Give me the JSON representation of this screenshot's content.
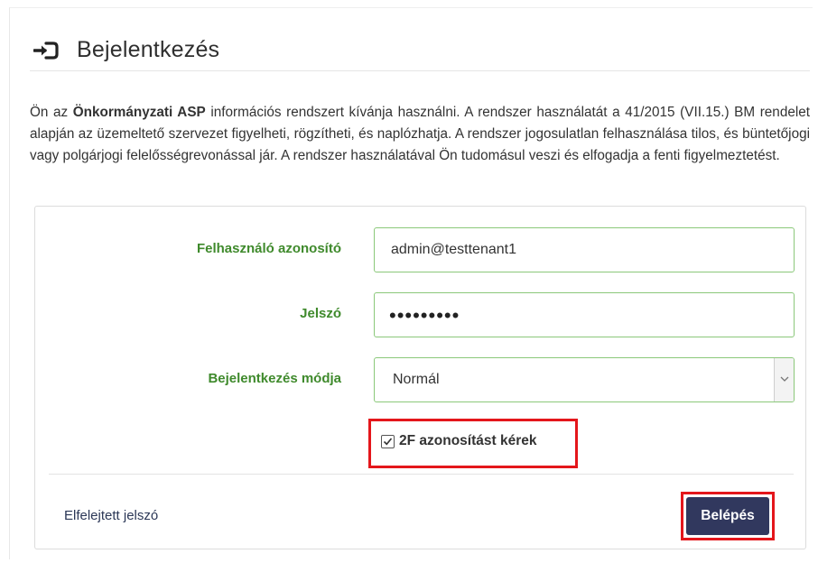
{
  "header": {
    "title": "Bejelentkezés",
    "icon": "login-icon"
  },
  "intro": {
    "part1": "Ön az ",
    "bold": "Önkormányzati ASP",
    "part2": " információs rendszert kívánja használni. A rendszer használatát a 41/2015 (VII.15.) BM rendelet alapján az üzemeltető szervezet figyelheti, rögzítheti, és naplózhatja. A rendszer jogosulatlan felhasználása tilos, és büntetőjogi vagy polgárjogi felelősségrevonással jár. A rendszer használatával Ön tudomásul veszi és elfogadja a fenti figyelmeztetést."
  },
  "form": {
    "username": {
      "label": "Felhasználó azonosító",
      "value": "admin@testtenant1"
    },
    "password": {
      "label": "Jelszó",
      "value": "•••••••••"
    },
    "login_mode": {
      "label": "Bejelentkezés módja",
      "selected": "Normál"
    },
    "two_factor": {
      "label": "2F azonosítást kérek",
      "checked": true
    }
  },
  "footer": {
    "forgot_password": "Elfelejtett jelszó",
    "submit": "Belépés"
  },
  "colors": {
    "label_green": "#3f8a2c",
    "input_border": "#8bc87a",
    "button_bg": "#31385e",
    "highlight_red": "#e4161b"
  }
}
